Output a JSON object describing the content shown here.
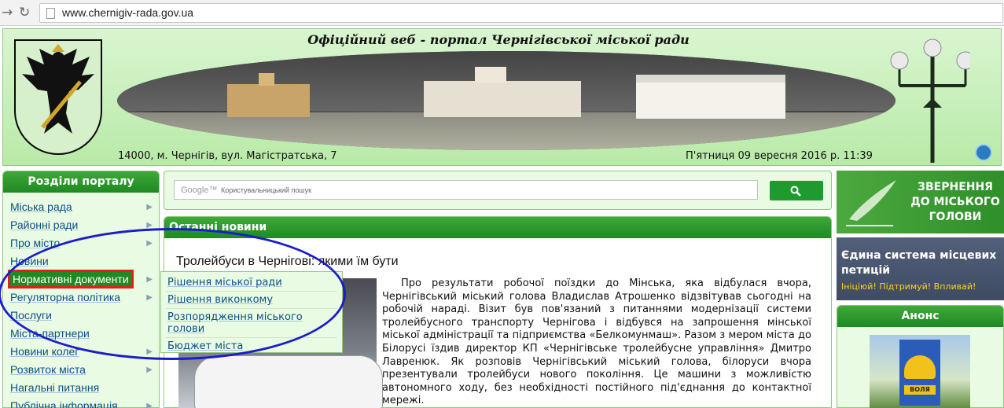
{
  "browser": {
    "back_icon": "arrow-left-icon",
    "reload_icon": "reload-icon",
    "url": "www.chernigiv-rada.gov.ua"
  },
  "header": {
    "title": "Офіційний веб - портал Чернігівської міської ради",
    "address": "14000, м. Чернігів, вул. Магістратська, 7",
    "date": "П'ятниця 09 вересня 2016 р. 11:39"
  },
  "sidebar": {
    "title": "Розділи порталу",
    "items": [
      {
        "label": "Міська рада",
        "arrow": "▶"
      },
      {
        "label": "Районні ради",
        "arrow": "▶"
      },
      {
        "label": "Про місто",
        "arrow": "▶"
      },
      {
        "label": "Новини",
        "arrow": ""
      },
      {
        "label": "Нормативні документи",
        "arrow": "▶"
      },
      {
        "label": "Регуляторна політика",
        "arrow": "▶"
      },
      {
        "label": "Послуги",
        "arrow": ""
      },
      {
        "label": "Міста-партнери",
        "arrow": ""
      },
      {
        "label": "Новини колег",
        "arrow": "▶"
      },
      {
        "label": "Розвиток міста",
        "arrow": "▶"
      },
      {
        "label": "Нагальні питання",
        "arrow": ""
      },
      {
        "label": "Публічна інформація",
        "arrow": "▶"
      }
    ]
  },
  "submenu": {
    "items": [
      "Рішення міської ради",
      "Рішення виконкому",
      "Розпорядження міського голови",
      "Бюджет міста"
    ]
  },
  "search": {
    "brand": "Google™",
    "placeholder": "Користувальницький пошук"
  },
  "news": {
    "section_title": "Останні новини",
    "headline": "Тролейбуси в Чернігові: якими їм бути",
    "body": "Про результати робочої поїздки до Мінська, яка відбулася вчора, Чернігівський міський голова Владислав Атрошенко відзвітував сьогодні на робочій нараді. Візит був пов'язаний з питаннями модернізації системи тролейбусного транспорту Чернігова і відбувся на запрошення мінської міської адміністрації та підприємства «Белкомунмаш». Разом з мером міста до Білорусі їздив директор КП «Чернігівське тролейбусне управління» Дмитро Лавренюк. Як розповів Чернігівський міський голова, білоруси вчора презентували тролейбуси нового покоління. Це машини з можливістю автономного ходу, без необхідності постійного під'єднання до контактної мережі."
  },
  "right": {
    "banner1": "ЗВЕРНЕННЯ ДО МІСЬКОГО ГОЛОВИ",
    "banner2_title": "Єдина система місцевих петицій",
    "banner2_sub": "Ініціюй! Підтримуй! Впливай!",
    "anons_title": "Анонс",
    "poster_text": "ВОЛЯ"
  },
  "colors": {
    "accent_green": "#1f8a22",
    "link_blue": "#0b4f8a",
    "highlight_red": "#e0211b",
    "annotation_blue": "#1c1ccc"
  }
}
